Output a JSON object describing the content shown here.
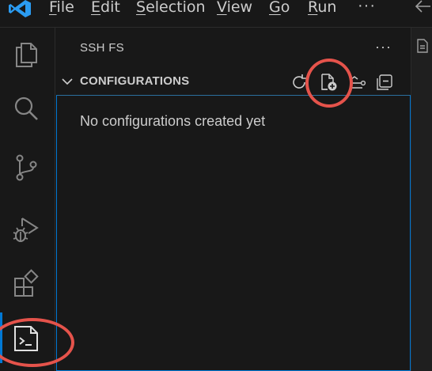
{
  "menu": {
    "items": [
      {
        "label": "File",
        "mnemonic": "F",
        "rest": "ile"
      },
      {
        "label": "Edit",
        "mnemonic": "E",
        "rest": "dit"
      },
      {
        "label": "Selection",
        "mnemonic": "S",
        "rest": "election"
      },
      {
        "label": "View",
        "mnemonic": "V",
        "rest": "iew"
      },
      {
        "label": "Go",
        "mnemonic": "G",
        "rest": "o"
      },
      {
        "label": "Run",
        "mnemonic": "R",
        "rest": "un"
      }
    ],
    "more": "···"
  },
  "activity_bar": {
    "items": [
      {
        "name": "explorer",
        "icon": "files-icon"
      },
      {
        "name": "search",
        "icon": "search-icon"
      },
      {
        "name": "source-control",
        "icon": "source-control-icon"
      },
      {
        "name": "run-and-debug",
        "icon": "run-debug-icon"
      },
      {
        "name": "extensions",
        "icon": "extensions-icon"
      },
      {
        "name": "ssh-fs",
        "icon": "terminal-icon",
        "active": true
      }
    ]
  },
  "sidebar": {
    "title": "SSH FS",
    "more": "···",
    "section": {
      "title": "CONFIGURATIONS",
      "actions": [
        "refresh-icon",
        "new-file-icon",
        "collapse-icon",
        "collapse-all-icon"
      ],
      "empty_message": "No configurations created yet"
    }
  },
  "colors": {
    "background": "#181818",
    "foreground": "#cccccc",
    "accent": "#0078d4",
    "annotation": "#e5534b"
  }
}
